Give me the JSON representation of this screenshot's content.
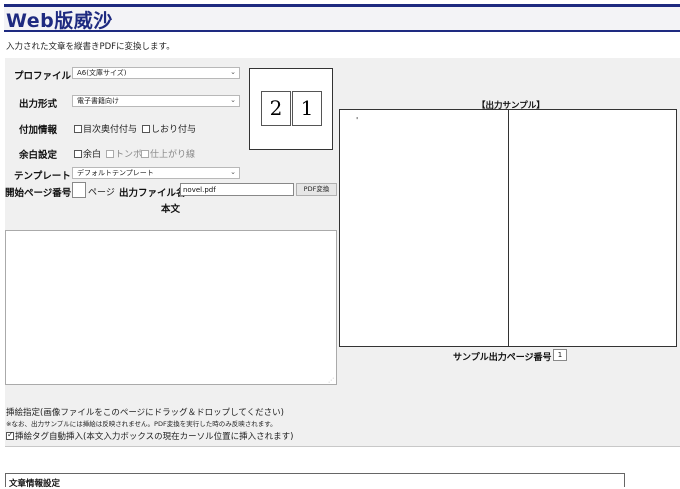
{
  "app": {
    "title": "Web版威沙",
    "lead": "入力された文章を縦書きPDFに変換します。"
  },
  "form": {
    "profile": {
      "label": "プロファイル",
      "value": "A6(文庫サイズ)"
    },
    "output_format": {
      "label": "出力形式",
      "value": "電子書籍向け"
    },
    "extra_info": {
      "label": "付加情報",
      "options": [
        {
          "label": "目次奥付付与",
          "checked": false
        },
        {
          "label": "しおり付与",
          "checked": false
        }
      ]
    },
    "margin": {
      "label": "余白設定",
      "options": [
        {
          "label": "余白",
          "checked": false,
          "disabled": false
        },
        {
          "label": "トンボ",
          "checked": false,
          "disabled": true
        },
        {
          "label": "仕上がり線",
          "checked": false,
          "disabled": true
        }
      ]
    },
    "template": {
      "label": "テンプレート",
      "value": "デフォルトテンプレート"
    },
    "start_page": {
      "label": "開始ページ番号",
      "value": "",
      "suffix": "ページ"
    },
    "output_file": {
      "label": "出力ファイル名",
      "value": "novel.pdf"
    },
    "convert_button": "PDF変換",
    "body_label": "本文",
    "body_text": ""
  },
  "page_preview": {
    "left": "2",
    "right": "1"
  },
  "sample": {
    "title": "【出力サンプル】",
    "mark": "'",
    "page_label": "サンプル出力ページ番号",
    "page_value": "1"
  },
  "illustration": {
    "line1": "挿絵指定(画像ファイルをこのページにドラッグ＆ドロップしてください)",
    "line2": "※なお、出力サンプルには挿絵は反映されません。PDF変換を実行した時のみ反映されます。",
    "auto_insert": {
      "label": "挿絵タグ自動挿入(本文入力ボックスの現在カーソル位置に挿入されます)",
      "checked": true
    }
  },
  "doc_info": {
    "title": "文章情報設定"
  }
}
